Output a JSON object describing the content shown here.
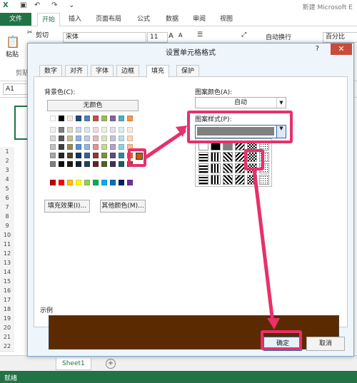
{
  "title_bar": {
    "doc_title": "新建 Microsoft E"
  },
  "ribbon_tabs": [
    "文件",
    "开始",
    "插入",
    "页面布局",
    "公式",
    "数据",
    "审阅",
    "视图"
  ],
  "ribbon": {
    "cut": "剪切",
    "paste": "粘贴",
    "clipboard_group": "剪贴",
    "font_name": "宋体",
    "font_size": "11",
    "wrap_text": "自动换行",
    "number_format": "百分比"
  },
  "formula_bar": {
    "namebox": "A1"
  },
  "row_numbers": [
    "1",
    "2",
    "3",
    "4",
    "5",
    "6",
    "7",
    "8",
    "9",
    "10",
    "11",
    "12",
    "13",
    "14",
    "15",
    "16",
    "17",
    "18",
    "19",
    "20",
    "21",
    "22"
  ],
  "sheet_tab": "Sheet1",
  "status": "就绪",
  "dialog": {
    "title": "设置单元格格式",
    "help": "?",
    "close": "✕",
    "tabs": [
      "数字",
      "对齐",
      "字体",
      "边框",
      "填充",
      "保护"
    ],
    "bg_color_label": "背景色(C):",
    "no_color_button": "无颜色",
    "fill_effects_button": "填充效果(I)...",
    "more_colors_button": "其他颜色(M)...",
    "pattern_color_label": "图案颜色(A):",
    "pattern_color_value": "自动",
    "pattern_style_label": "图案样式(P):",
    "sample_label": "示例",
    "ok_button": "确定",
    "cancel_button": "取消",
    "sample_color": "#5b2a00",
    "selected_bg_color": "#c55a11",
    "pattern_style_color": "#808080"
  },
  "theme_colors": [
    [
      "#ffffff",
      "#000000",
      "#eeece1",
      "#1f497d",
      "#4f81bd",
      "#c0504d",
      "#9bbb59",
      "#8064a2",
      "#4bacc6",
      "#f79646"
    ],
    [
      "#f2f2f2",
      "#7f7f7f",
      "#ddd9c4",
      "#c6d9f1",
      "#dce6f2",
      "#f2dcdb",
      "#ebf1de",
      "#e6e0ec",
      "#dbeef4",
      "#fde9d9"
    ],
    [
      "#d9d9d9",
      "#595959",
      "#c4bd97",
      "#8eb4e3",
      "#b9cde5",
      "#e6b9b8",
      "#d7e4bd",
      "#ccc1da",
      "#b7dee8",
      "#fcd5b5"
    ],
    [
      "#bfbfbf",
      "#3f3f3f",
      "#948a54",
      "#558ed5",
      "#95b3d7",
      "#d99694",
      "#c3d69b",
      "#b3a2c7",
      "#93cddd",
      "#fac090"
    ],
    [
      "#a6a6a6",
      "#262626",
      "#4a452a",
      "#17375e",
      "#376092",
      "#953735",
      "#77933c",
      "#604a7b",
      "#31859c",
      "#e46c0a"
    ],
    [
      "#808080",
      "#0d0d0d",
      "#1e1c11",
      "#10243f",
      "#254061",
      "#632523",
      "#4f6228",
      "#403152",
      "#215968",
      "#974806"
    ]
  ],
  "standard_colors": [
    "#c00000",
    "#ff0000",
    "#ffc000",
    "#ffff00",
    "#92d050",
    "#00b050",
    "#00b0f0",
    "#0070c0",
    "#002060",
    "#7030a0"
  ]
}
